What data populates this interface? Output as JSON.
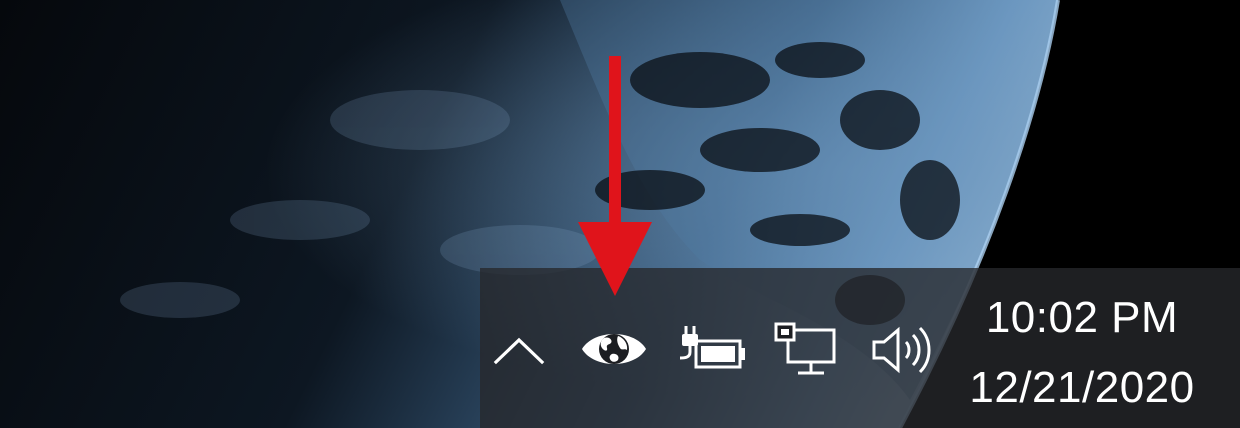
{
  "tray": {
    "icons": [
      {
        "name": "chevron-up-icon",
        "label": "show hidden icons"
      },
      {
        "name": "eye-globe-icon",
        "label": "tray app icon"
      },
      {
        "name": "battery-charging-icon",
        "label": "battery"
      },
      {
        "name": "network-icon",
        "label": "network"
      },
      {
        "name": "volume-icon",
        "label": "volume"
      }
    ]
  },
  "clock": {
    "time": "10:02 PM",
    "date": "12/21/2020"
  },
  "colors": {
    "taskbar": "#26282c",
    "icon": "#ffffff",
    "arrow": "#e0141b",
    "earth_blue": "#6f9cc7"
  }
}
